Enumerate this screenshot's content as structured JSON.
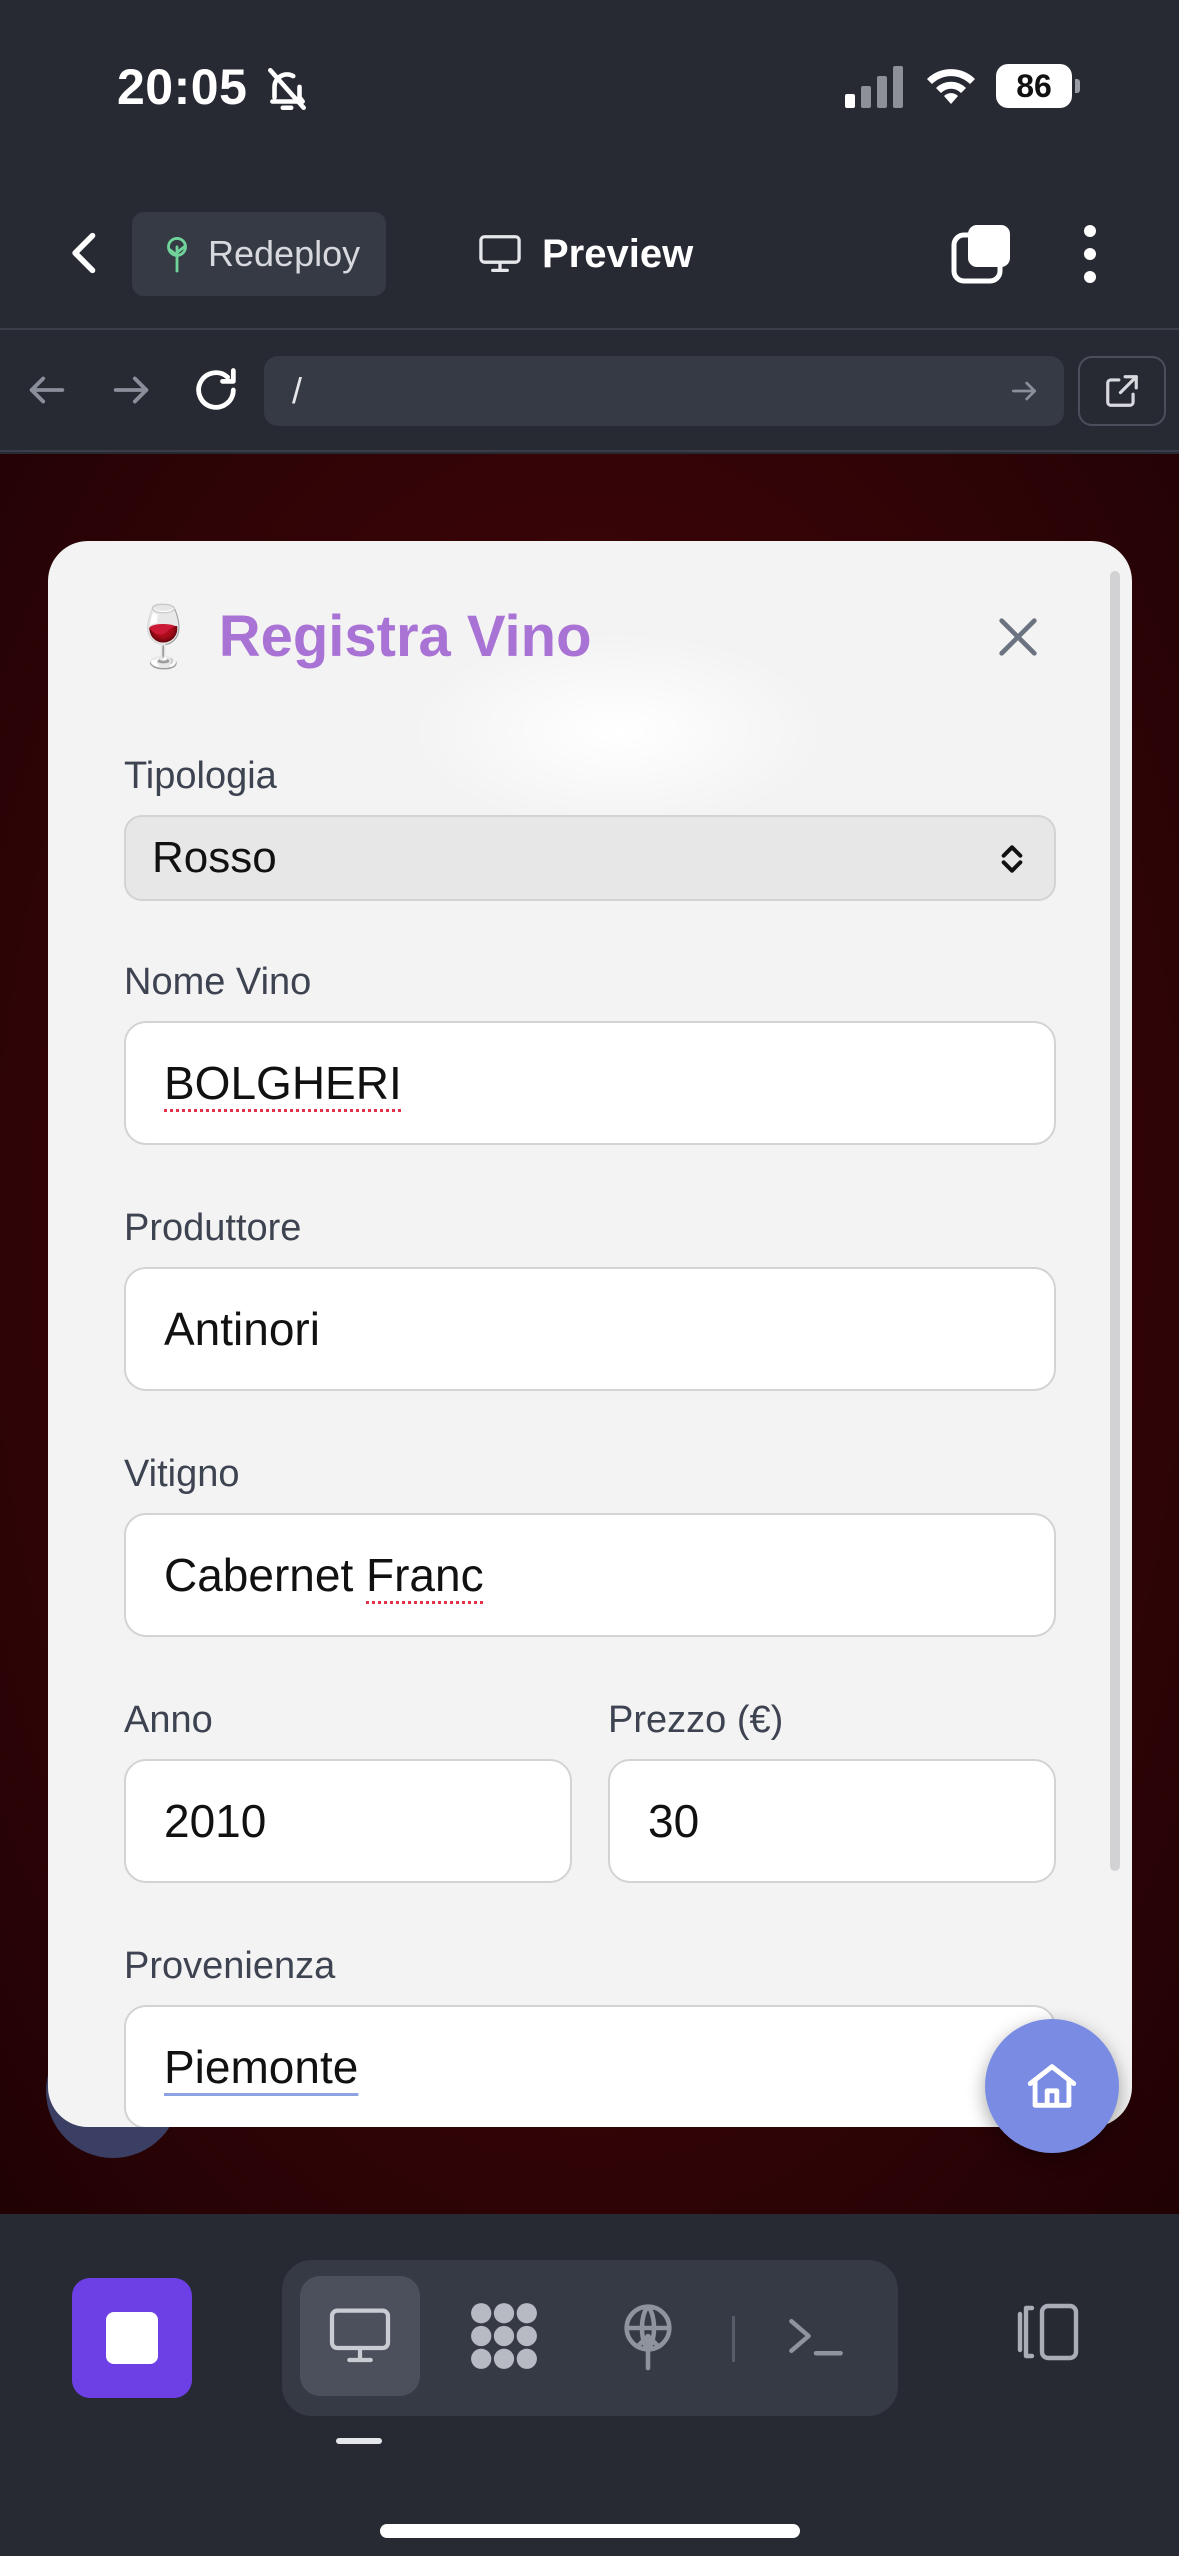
{
  "status_bar": {
    "time": "20:05",
    "battery": "86",
    "icons": [
      "bell-slash-icon",
      "cellular-signal-icon",
      "wifi-icon",
      "battery-icon"
    ]
  },
  "app_bar": {
    "redeploy_label": "Redeploy",
    "preview_label": "Preview",
    "icons": [
      "back-chevron-icon",
      "tree-icon",
      "monitor-icon",
      "tabs-icon",
      "kebab-menu-icon"
    ]
  },
  "url_bar": {
    "url": "/"
  },
  "modal": {
    "emoji": "🍷",
    "title": "Registra Vino",
    "fields": {
      "tipologia": {
        "label": "Tipologia",
        "value": "Rosso"
      },
      "nome_vino": {
        "label": "Nome Vino",
        "value": "BOLGHERI"
      },
      "produttore": {
        "label": "Produttore",
        "value": "Antinori"
      },
      "vitigno": {
        "label": "Vitigno",
        "value_prefix": "Cabernet ",
        "value_flagged": "Franc"
      },
      "anno": {
        "label": "Anno",
        "value": "2010"
      },
      "prezzo": {
        "label": "Prezzo (€)",
        "value": "30"
      },
      "provenienza": {
        "label": "Provenienza",
        "value": "Piemonte"
      }
    }
  },
  "colors": {
    "accent_purple": "#a873d4",
    "stop_button": "#6d40e6",
    "home_fab": "#7a8be3",
    "background_dark": "#272a33",
    "webview_red": "#3a0508"
  }
}
